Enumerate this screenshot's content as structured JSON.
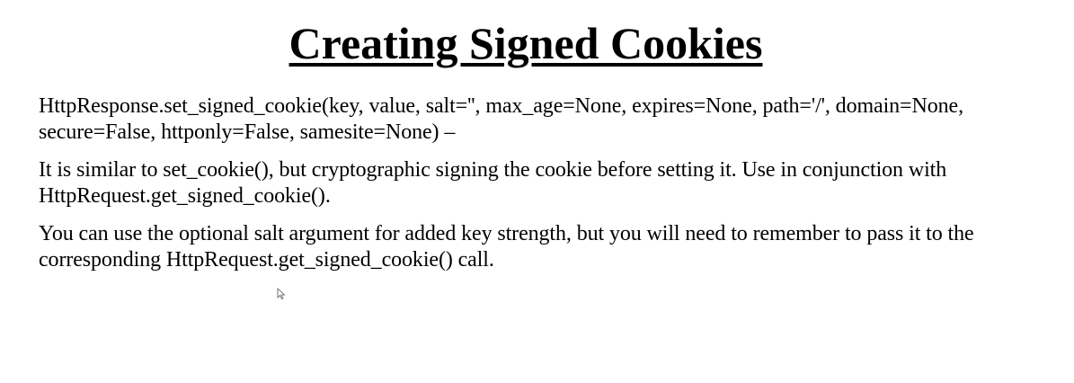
{
  "slide": {
    "title": "Creating Signed Cookies",
    "paragraphs": [
      "HttpResponse.set_signed_cookie(key, value, salt='', max_age=None, expires=None, path='/', domain=None, secure=False, httponly=False, samesite=None) –",
      "It is similar to set_cookie(), but cryptographic signing the cookie before setting it. Use in conjunction with HttpRequest.get_signed_cookie().",
      "You can use the optional salt argument for added key strength, but you will need to remember to pass it to the corresponding HttpRequest.get_signed_cookie() call."
    ]
  },
  "cursor": {
    "icon": "mouse-pointer-icon"
  }
}
